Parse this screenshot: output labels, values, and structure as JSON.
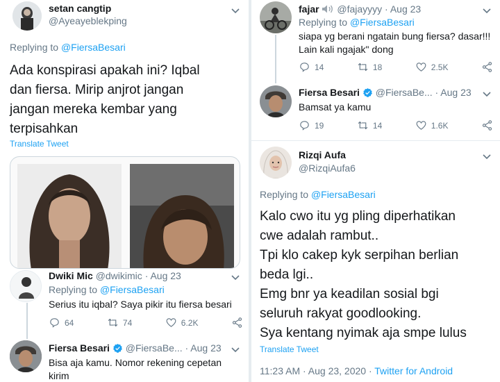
{
  "left": {
    "top_tweet": {
      "name": "setan cangtip",
      "handle": "@Ayeayeblekping",
      "replying_prefix": "Replying to",
      "replying_to": "@FiersaBesari",
      "text_lines": [
        "Ada konspirasi apakah ini? Iqbal",
        "dan fiersa. Mirip anjrot jangan",
        "jangan mereka kembar yang",
        "terpisahkan"
      ],
      "translate": "Translate Tweet"
    },
    "reply1": {
      "name": "Dwiki Mic",
      "handle": "@dwikimic",
      "date": "· Aug 23",
      "replying_prefix": "Replying to",
      "replying_to": "@FiersaBesari",
      "text": "Serius itu iqbal? Saya pikir itu fiersa besari",
      "replies": "64",
      "retweets": "74",
      "likes": "6.2K"
    },
    "reply2": {
      "name": "Fiersa Besari",
      "handle": "@FiersaBe...",
      "date": "· Aug 23",
      "text_lines": [
        "Bisa aja kamu. Nomor rekening cepetan",
        "kirim"
      ]
    }
  },
  "right": {
    "reply1": {
      "name": "fajar",
      "handle": "@fajayyyy",
      "date": "· Aug 23",
      "replying_prefix": "Replying to",
      "replying_to": "@FiersaBesari",
      "text_lines": [
        "siapa yg berani ngatain bung fiersa? dasar!!!",
        "Lain kali ngajak\" dong"
      ],
      "replies": "14",
      "retweets": "18",
      "likes": "2.5K"
    },
    "reply2": {
      "name": "Fiersa Besari",
      "handle": "@FiersaBe...",
      "date": "· Aug 23",
      "text": "Bamsat ya kamu",
      "replies": "19",
      "retweets": "14",
      "likes": "1.6K"
    },
    "main_tweet": {
      "name": "Rizqi Aufa",
      "handle": "@RizqiAufa6",
      "replying_prefix": "Replying to",
      "replying_to": "@FiersaBesari",
      "text_lines": [
        "Kalo cwo itu yg pling diperhatikan",
        "cwe adalah rambut..",
        "Tpi klo cakep kyk serpihan berlian",
        "beda lgi..",
        "Emg bnr ya keadilan sosial bgi",
        "seluruh rakyat goodlooking.",
        "Sya kentang nyimak aja smpe lulus"
      ],
      "translate": "Translate Tweet",
      "time": "11:23 AM · Aug 23, 2020 · ",
      "source": "Twitter for Android"
    }
  },
  "colors": {
    "link": "#1da1f2",
    "secondary": "#657786",
    "text": "#14171a",
    "verified": "#1da1f2"
  },
  "icons": [
    "chevron-down-icon",
    "reply-icon",
    "retweet-icon",
    "like-icon",
    "share-icon",
    "verified-icon",
    "speaker-icon"
  ]
}
